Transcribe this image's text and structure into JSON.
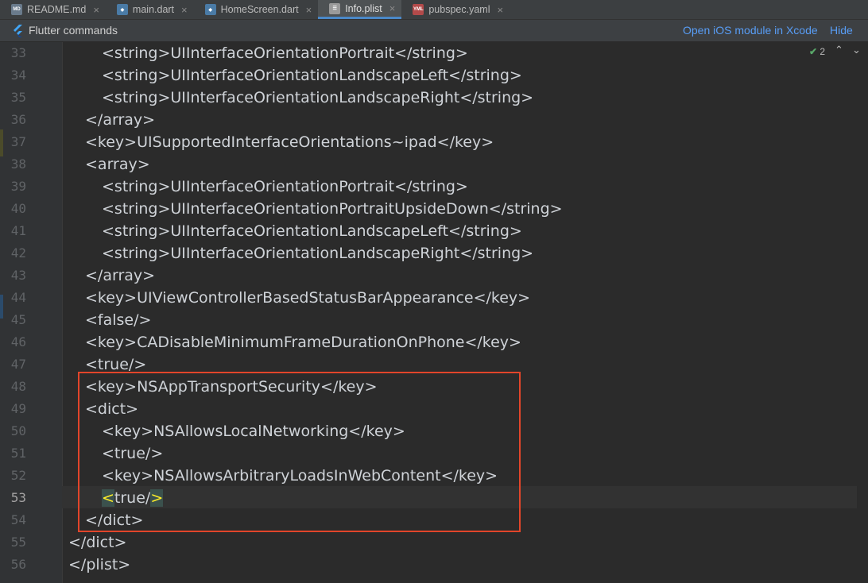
{
  "tabs": [
    {
      "label": "README.md",
      "icon": "markdown-file-icon",
      "active": false
    },
    {
      "label": "main.dart",
      "icon": "dart-file-icon",
      "active": false
    },
    {
      "label": "HomeScreen.dart",
      "icon": "dart-file-icon",
      "active": false
    },
    {
      "label": "Info.plist",
      "icon": "plist-file-icon",
      "active": true
    },
    {
      "label": "pubspec.yaml",
      "icon": "yaml-file-icon",
      "active": false
    }
  ],
  "tab_close_glyph": "×",
  "flutter_bar": {
    "title": "Flutter commands",
    "open_ios_link": "Open iOS module in Xcode",
    "hide_link": "Hide"
  },
  "inspections": {
    "count": "2"
  },
  "editor": {
    "current_line": 53,
    "line_numbers": [
      "33",
      "34",
      "35",
      "36",
      "37",
      "38",
      "39",
      "40",
      "41",
      "42",
      "43",
      "44",
      "45",
      "46",
      "47",
      "48",
      "49",
      "50",
      "51",
      "52",
      "53",
      "54",
      "55",
      "56"
    ],
    "lines": [
      "<string>UIInterfaceOrientationPortrait</string>",
      "<string>UIInterfaceOrientationLandscapeLeft</string>",
      "<string>UIInterfaceOrientationLandscapeRight</string>",
      "</array>",
      "<key>UISupportedInterfaceOrientations~ipad</key>",
      "<array>",
      "<string>UIInterfaceOrientationPortrait</string>",
      "<string>UIInterfaceOrientationPortraitUpsideDown</string>",
      "<string>UIInterfaceOrientationLandscapeLeft</string>",
      "<string>UIInterfaceOrientationLandscapeRight</string>",
      "</array>",
      "<key>UIViewControllerBasedStatusBarAppearance</key>",
      "<false/>",
      "<key>CADisableMinimumFrameDurationOnPhone</key>",
      "<true/>",
      "<key>NSAppTransportSecurity</key>",
      "<dict>",
      "<key>NSAllowsLocalNetworking</key>",
      "<true/>",
      "<key>NSAllowsArbitraryLoadsInWebContent</key>",
      "<true/>",
      "</dict>",
      "</dict>",
      "</plist>"
    ]
  },
  "colors": {
    "highlight_box": "#e2452a",
    "link": "#589df6",
    "bracket_match": "#ffef28"
  }
}
